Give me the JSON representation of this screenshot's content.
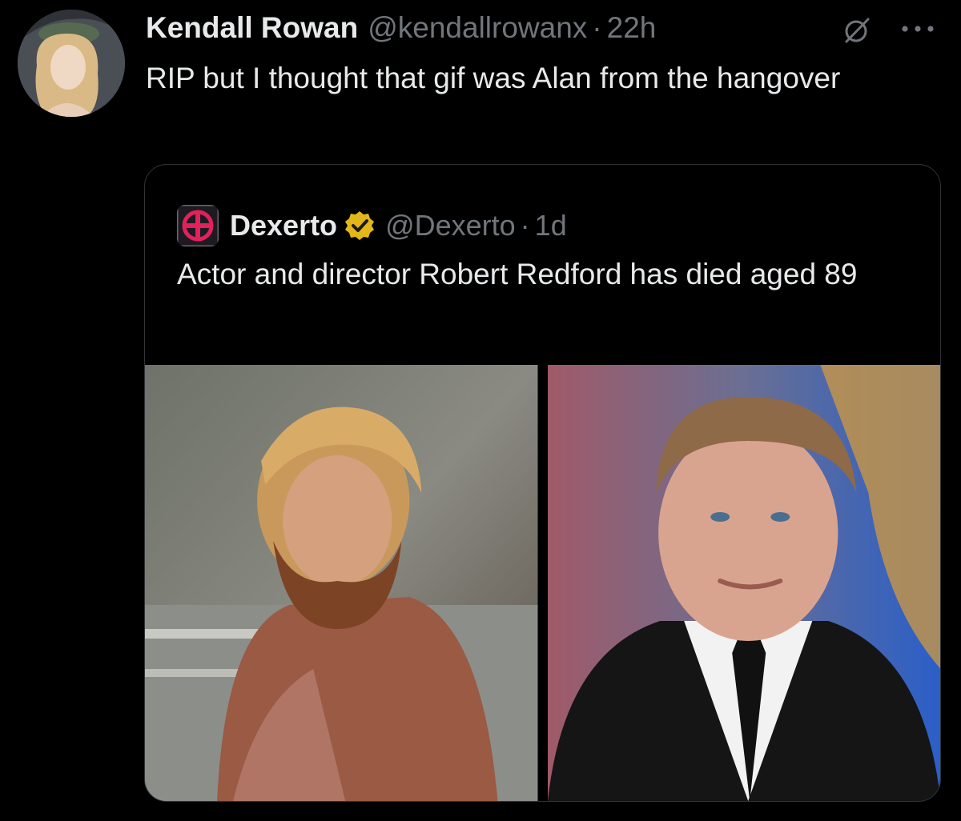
{
  "tweet": {
    "author_name": "Kendall Rowan",
    "author_handle": "@kendallrowanx",
    "separator": "·",
    "time": "22h",
    "text": "RIP but I thought that gif was Alan from the hangover"
  },
  "quote": {
    "author_name": "Dexerto",
    "author_handle": "@Dexerto",
    "separator": "·",
    "time": "1d",
    "text": "Actor and director Robert Redford has died aged 89",
    "verified_color": "#e2b719",
    "brand_color": "#e2215b"
  },
  "colors": {
    "background": "#000000",
    "primary_text": "#e7e9ea",
    "secondary_text": "#71767b",
    "border": "#2f3336"
  },
  "icons": {
    "grok": "grok-icon",
    "more": "more-options-icon",
    "verified": "verified-badge-icon"
  }
}
